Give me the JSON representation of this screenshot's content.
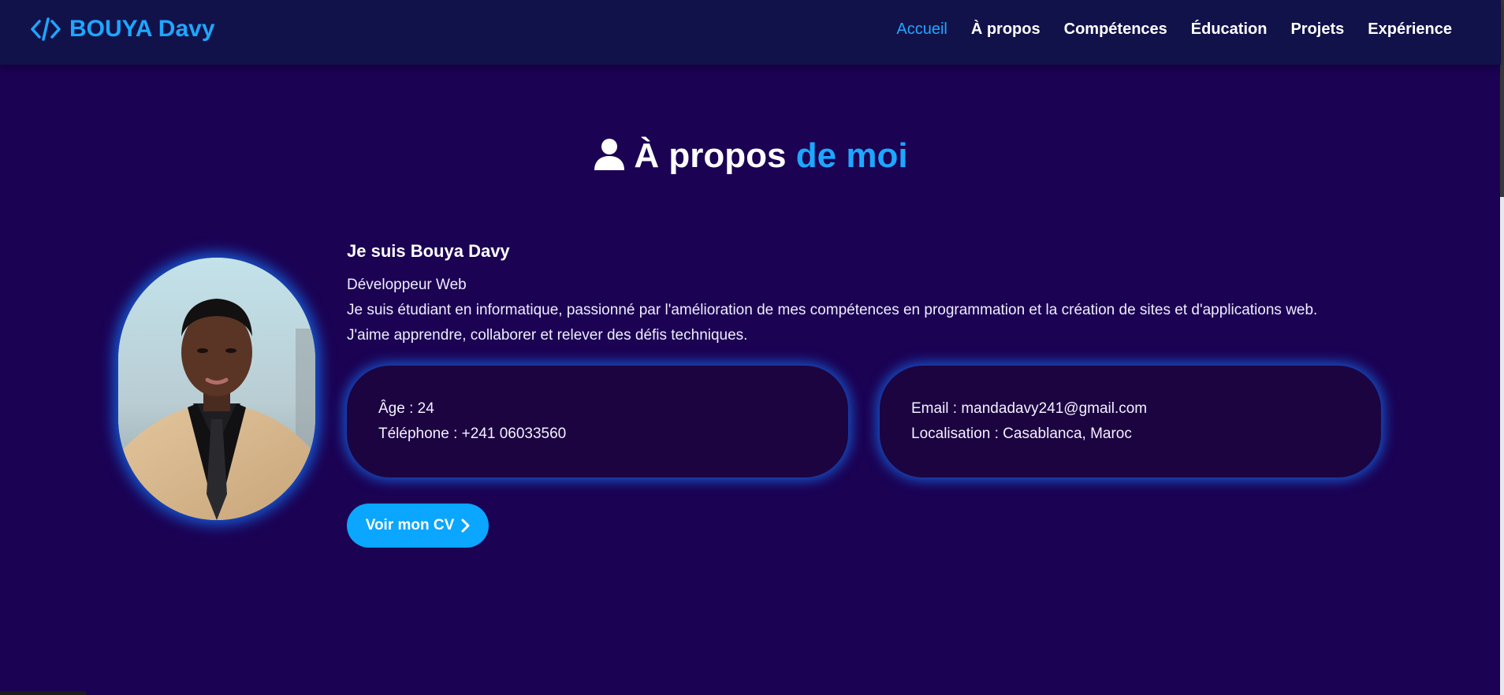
{
  "navbar": {
    "brand": "BOUYA Davy",
    "brand_icon": "code-icon",
    "links": [
      {
        "label": "Accueil",
        "active": true
      },
      {
        "label": "À propos",
        "active": false
      },
      {
        "label": "Compétences",
        "active": false
      },
      {
        "label": "Éducation",
        "active": false
      },
      {
        "label": "Projets",
        "active": false
      },
      {
        "label": "Expérience",
        "active": false
      }
    ]
  },
  "section": {
    "icon": "user-icon",
    "title_main": "À propos",
    "title_accent": "de moi"
  },
  "about": {
    "name": "Je suis Bouya Davy",
    "role": "Développeur Web",
    "description_line1": "Je suis étudiant en informatique, passionné par l'amélioration de mes compétences en programmation et la création de sites et d'applications web.",
    "description_line2": "J'aime apprendre, collaborer et relever des défis techniques."
  },
  "info": {
    "age": "Âge : 24",
    "phone": "Téléphone : +241 06033560",
    "email": "Email : mandadavy241@gmail.com",
    "location": "Localisation : Casablanca, Maroc"
  },
  "cv_button": {
    "label": "Voir mon CV",
    "icon": "chevron-right-icon"
  },
  "colors": {
    "background": "#1b0253",
    "navbar": "#12124a",
    "accent": "#1ea7ff",
    "card": "#1c0441",
    "glow": "#1478ff"
  }
}
